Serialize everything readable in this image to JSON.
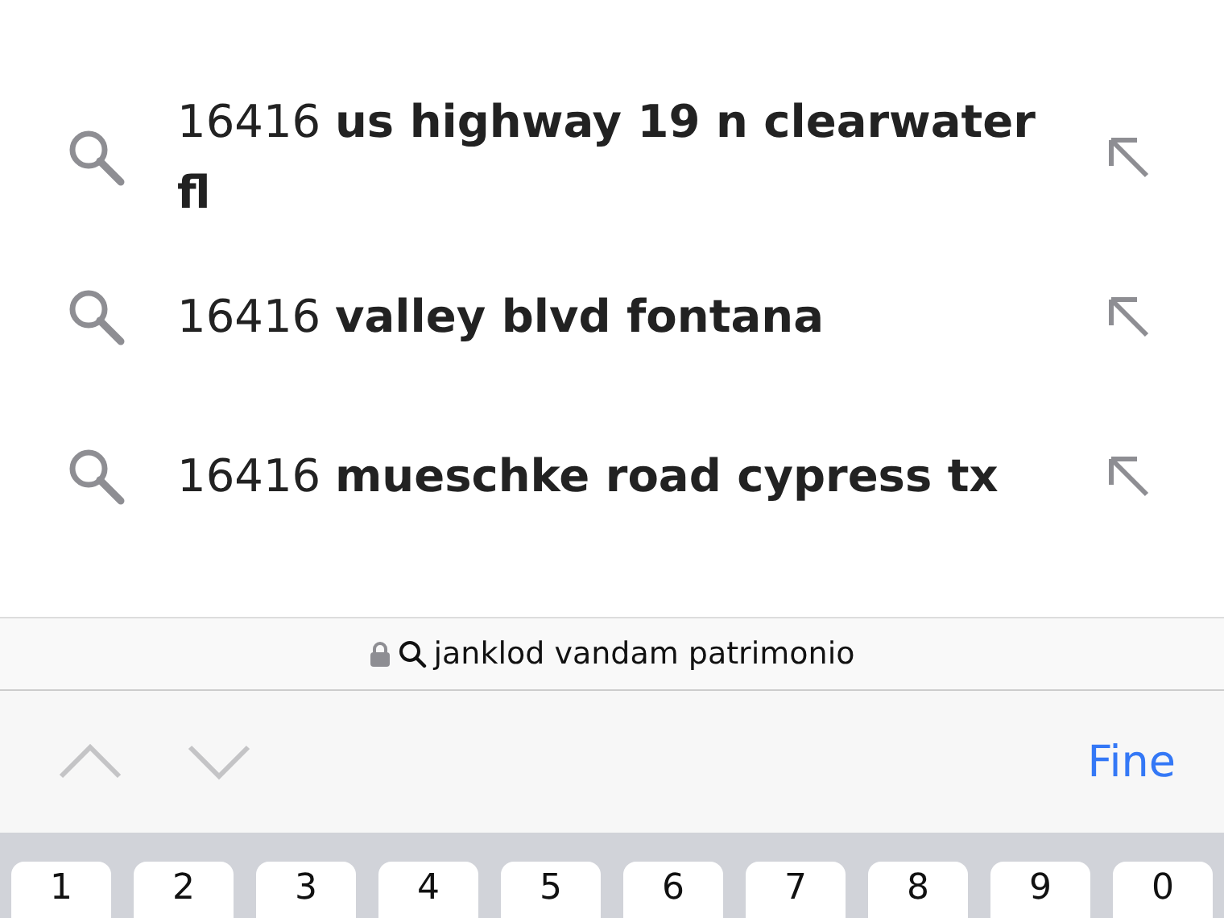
{
  "suggestions": [
    {
      "text": "16416 **us highway 19 n clearwater fl**"
    },
    {
      "text": "16416 **valley blvd fontana**"
    },
    {
      "text": "16416 **mueschke road cypress tx**"
    }
  ],
  "address_bar": {
    "text": "janklod vandam patrimonio"
  },
  "toolbar": {
    "done": "Fine"
  },
  "keyboard": {
    "keys": [
      "1",
      "2",
      "3",
      "4",
      "5",
      "6",
      "7",
      "8",
      "9",
      "0"
    ]
  }
}
